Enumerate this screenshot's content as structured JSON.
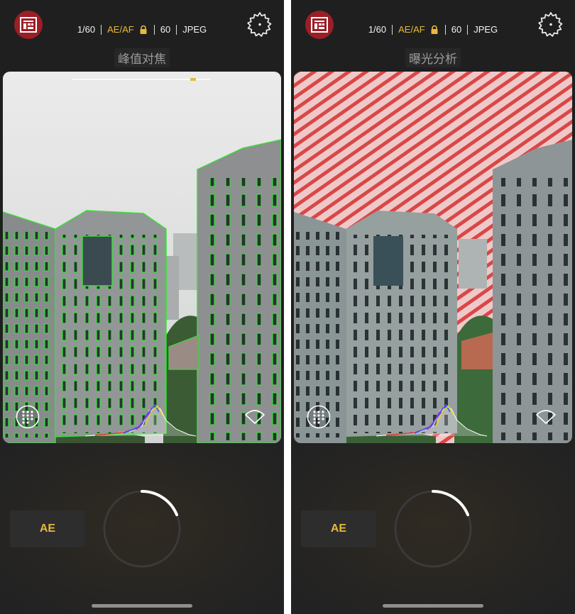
{
  "screens": [
    {
      "app_icon": "film-logo-icon",
      "status": {
        "shutter": "1/60",
        "exposure_mode": "AE/AF",
        "iso": "60",
        "format": "JPEG"
      },
      "mode_label": "峰值对焦",
      "overlay": "focus-peaking",
      "ae_button": "AE"
    },
    {
      "app_icon": "film-logo-icon",
      "status": {
        "shutter": "1/60",
        "exposure_mode": "AE/AF",
        "iso": "60",
        "format": "JPEG"
      },
      "mode_label": "曝光分析",
      "overlay": "exposure-zebra",
      "ae_button": "AE"
    }
  ],
  "colors": {
    "accent": "#e8b93a",
    "logo": "#9b1f27",
    "peaking": "#2de02d",
    "zebra": "#d83a3a"
  }
}
